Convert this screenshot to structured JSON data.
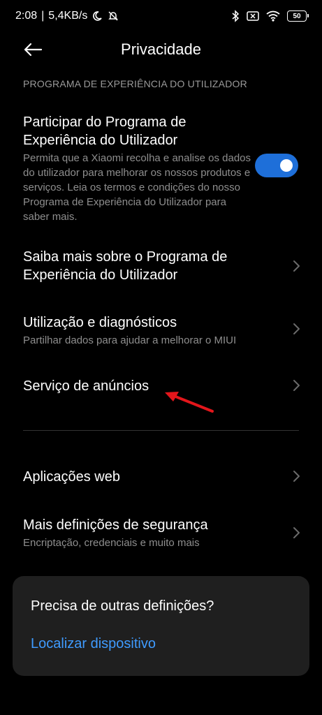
{
  "status_bar": {
    "time": "2:08",
    "network_speed": "5,4KB/s",
    "battery": "50",
    "icons": [
      "moon-icon",
      "silent-icon",
      "bluetooth-icon",
      "sim-off-icon",
      "wifi-icon",
      "battery-icon"
    ]
  },
  "header": {
    "title": "Privacidade",
    "back_icon": "arrow-left-icon"
  },
  "section": {
    "label": "PROGRAMA DE EXPERIÊNCIA DO UTILIZADOR"
  },
  "items": [
    {
      "title": "Participar do Programa de Experiência do Utilizador",
      "subtitle": "Permita que a Xiaomi recolha e analise os dados do utilizador para melhorar os nossos produtos e serviços. Leia os termos e condições do nosso Programa de Experiência do Utilizador para saber mais.",
      "toggle": true
    },
    {
      "title": "Saiba mais sobre o Programa de Experiência do Utilizador",
      "subtitle": ""
    },
    {
      "title": "Utilização e diagnósticos",
      "subtitle": "Partilhar dados para ajudar a melhorar o MIUI"
    },
    {
      "title": "Serviço de anúncios",
      "subtitle": ""
    },
    {
      "title": "Aplicações web",
      "subtitle": ""
    },
    {
      "title": "Mais definições de segurança",
      "subtitle": "Encriptação, credenciais e muito mais"
    }
  ],
  "card": {
    "question": "Precisa de outras definições?",
    "link": "Localizar dispositivo"
  },
  "colors": {
    "background": "#000000",
    "accent": "#1e6fd9",
    "link": "#3f9bff",
    "annotation_arrow": "#e3161b"
  }
}
